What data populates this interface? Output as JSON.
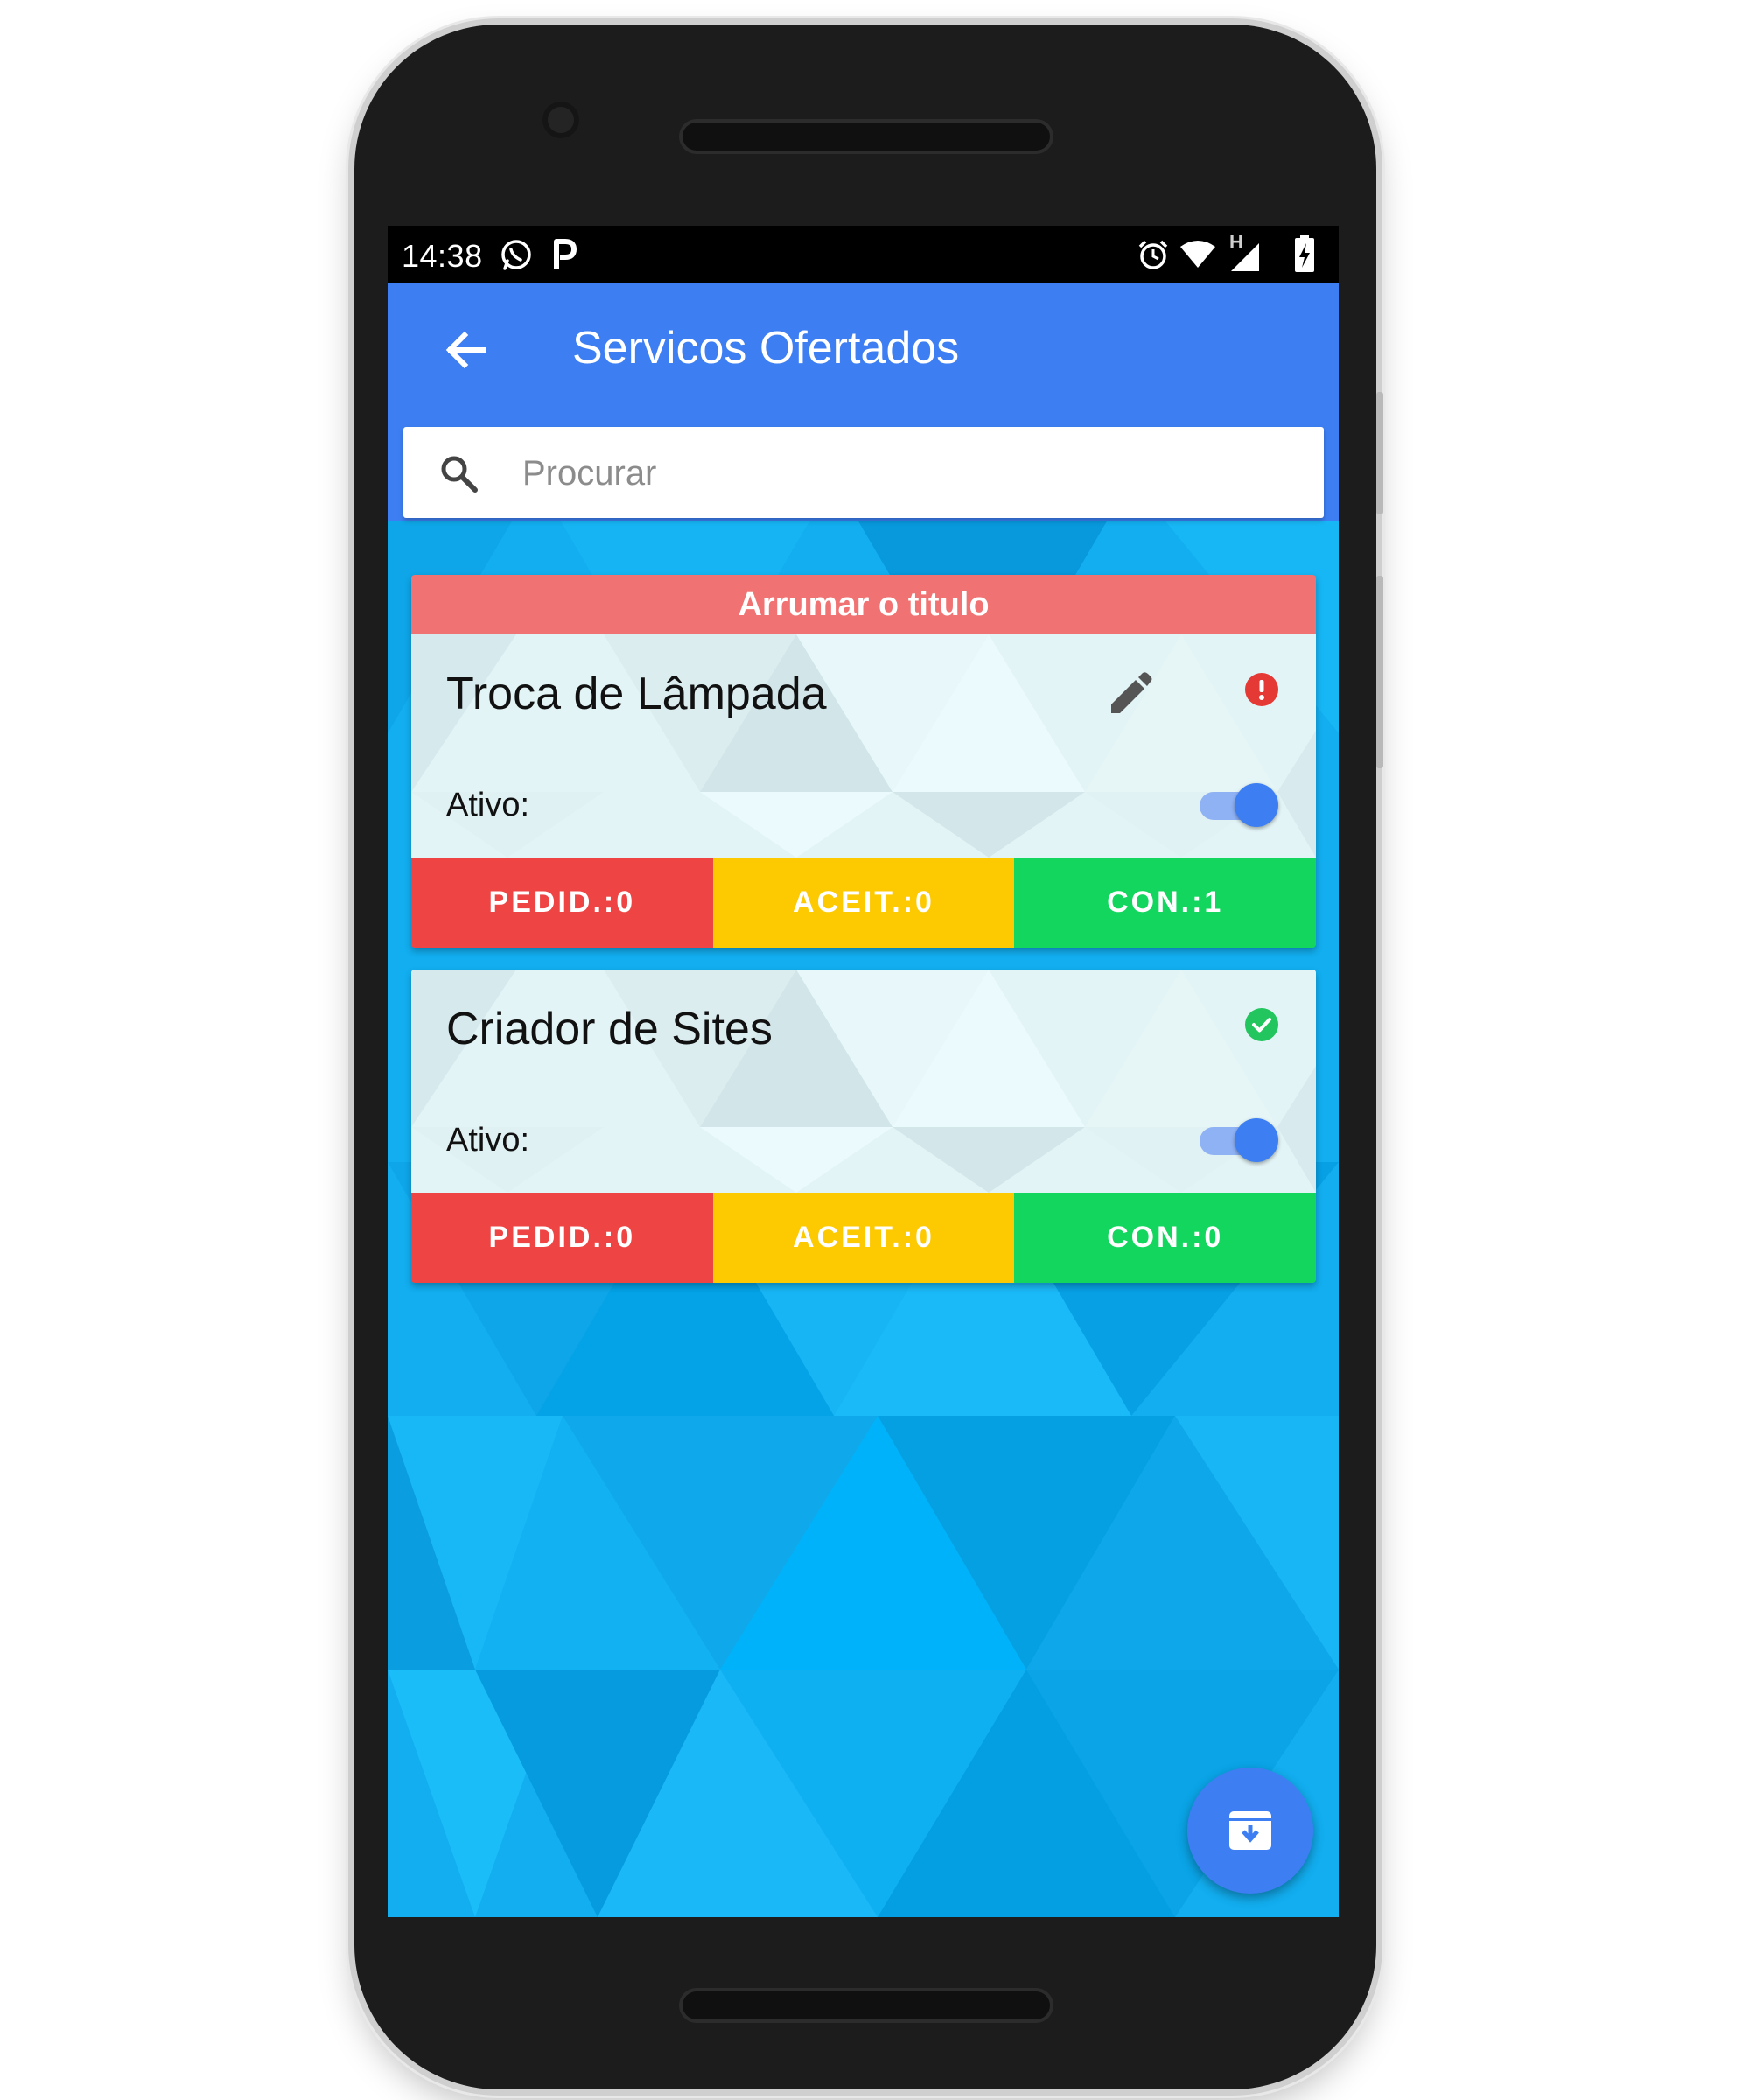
{
  "status_bar": {
    "time": "14:38",
    "left_icons": [
      "whatsapp-icon",
      "parking-app-icon"
    ],
    "right_icons": [
      "alarm-icon",
      "wifi-icon",
      "signal-h-icon",
      "battery-charging-icon"
    ],
    "network_label": "H"
  },
  "app_bar": {
    "back_icon": "arrow-left-icon",
    "title": "Servicos Ofertados"
  },
  "search": {
    "icon": "search-icon",
    "placeholder": "Procurar",
    "value": ""
  },
  "services": [
    {
      "banner": "Arrumar o titulo",
      "title": "Troca de Lâmpada",
      "active_label": "Ativo:",
      "active": true,
      "status": "error",
      "status_color": "#e53935",
      "show_edit": true,
      "pedidos_label": "PEDID.:0",
      "aceitos_label": "ACEIT.:0",
      "concluidos_label": "CON.:1"
    },
    {
      "title": "Criador de Sites",
      "active_label": "Ativo:",
      "active": true,
      "status": "ok",
      "status_color": "#22c55e",
      "show_edit": false,
      "pedidos_label": "PEDID.:0",
      "aceitos_label": "ACEIT.:0",
      "concluidos_label": "CON.:0"
    }
  ],
  "fab": {
    "icon": "archive-download-icon"
  },
  "colors": {
    "primary": "#3d7ff3",
    "banner": "#f07272",
    "pedidos": "#ef4444",
    "aceitos": "#fdc900",
    "concluidos": "#12d65e",
    "background": "#12aef0"
  }
}
